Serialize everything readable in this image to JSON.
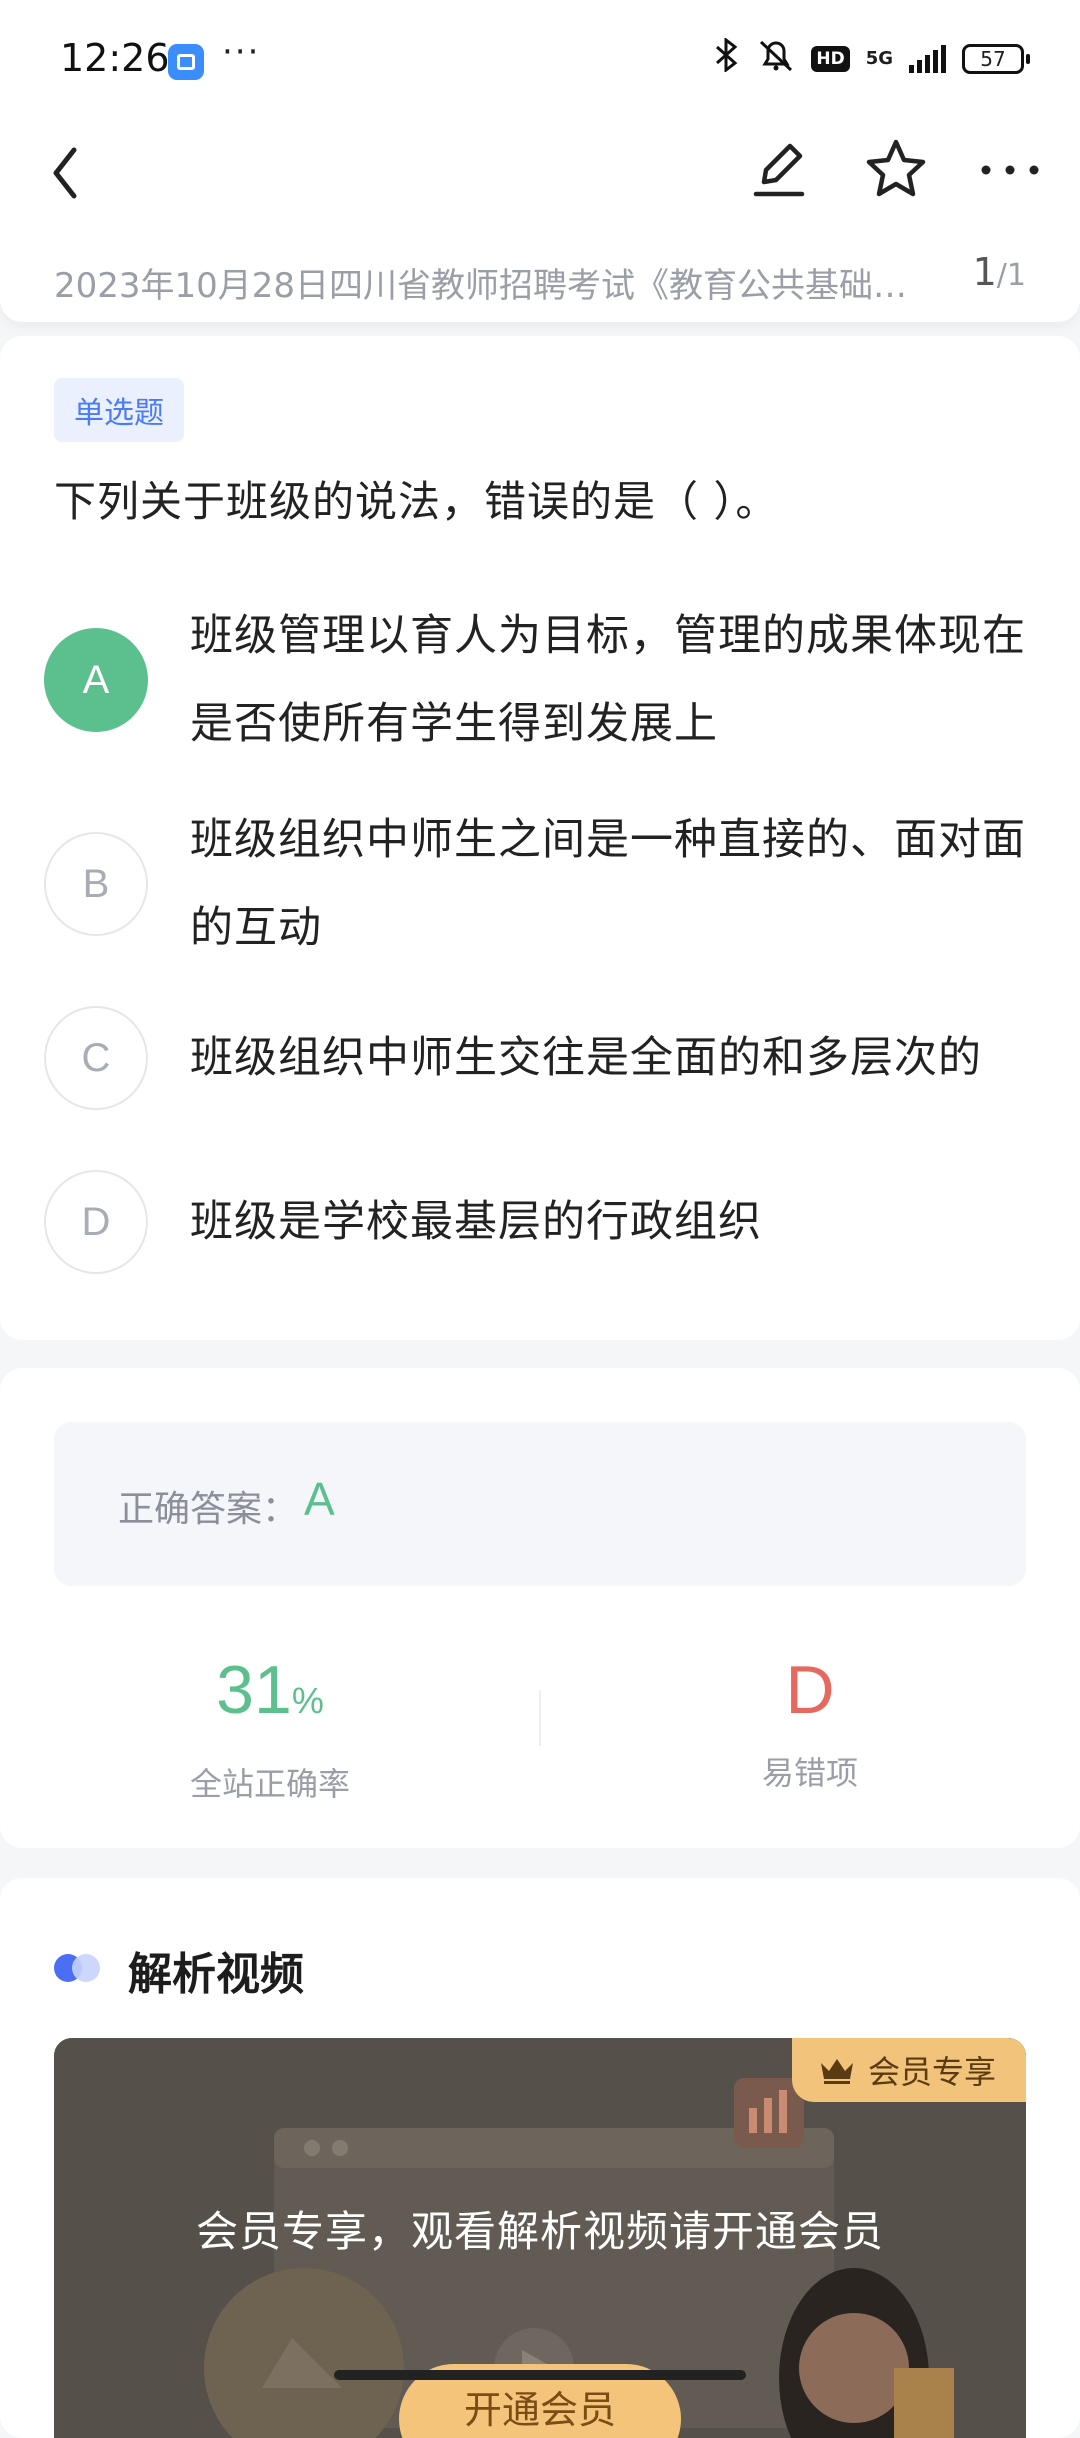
{
  "status_bar": {
    "time": "12:26",
    "dots": "···",
    "network": "5G",
    "battery": "57"
  },
  "nav": {
    "back_icon": "chevron-left-icon",
    "edit_icon": "pencil-icon",
    "star_icon": "star-icon",
    "more_icon": "more-horizontal-icon"
  },
  "header": {
    "exam_title": "2023年10月28日四川省教师招聘考试《教育公共基础…",
    "page_current": "1",
    "page_total": "/1"
  },
  "question": {
    "type_tag": "单选题",
    "stem": "下列关于班级的说法，错误的是（  ）。",
    "options": [
      {
        "letter": "A",
        "text": "班级管理以育人为目标，管理的成果体现在是否使所有学生得到发展上",
        "correct": true
      },
      {
        "letter": "B",
        "text": "班级组织中师生之间是一种直接的、面对面的互动",
        "correct": false
      },
      {
        "letter": "C",
        "text": "班级组织中师生交往是全面的和多层次的",
        "correct": false
      },
      {
        "letter": "D",
        "text": "班级是学校最基层的行政组织",
        "correct": false
      }
    ]
  },
  "answer": {
    "label": "正确答案：",
    "value": "A",
    "accuracy_value": "31",
    "accuracy_unit": "%",
    "accuracy_caption": "全站正确率",
    "wrong_option_value": "D",
    "wrong_option_caption": "易错项"
  },
  "video": {
    "section_title": "解析视频",
    "vip_tag": "会员专享",
    "message": "会员专享，观看解析视频请开通会员",
    "button_label": "开通会员"
  },
  "colors": {
    "correct_green": "#5bc08d",
    "wrong_red": "#e5695f",
    "tag_blue": "#4b7cf5",
    "vip_gold": "#f2c37a"
  }
}
